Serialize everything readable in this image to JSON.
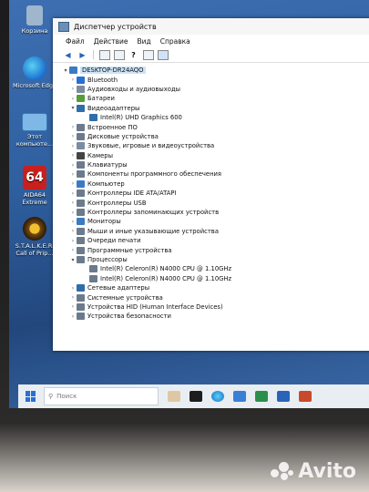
{
  "desktop": {
    "icons": [
      {
        "label": "Корзина"
      },
      {
        "label": "Microsoft Edge"
      },
      {
        "label": "Этот компьюте..."
      },
      {
        "label": "AIDA64 Extreme",
        "badge": "64"
      },
      {
        "label": "S.T.A.L.K.E.R. Call of Prip..."
      }
    ]
  },
  "window": {
    "title": "Диспетчер устройств",
    "menu": [
      "Файл",
      "Действие",
      "Вид",
      "Справка"
    ]
  },
  "tree": {
    "root": "DESKTOP-DR24AQO",
    "items": [
      {
        "label": "Bluetooth",
        "icon": "bluetooth-icon",
        "color": "#2a6fd6",
        "expanded": false
      },
      {
        "label": "Аудиовходы и аудиовыходы",
        "icon": "speaker-icon",
        "color": "#7b8ca0",
        "expanded": false
      },
      {
        "label": "Батареи",
        "icon": "battery-icon",
        "color": "#5a9c3a",
        "expanded": false
      },
      {
        "label": "Видеоадаптеры",
        "icon": "display-adapter-icon",
        "color": "#2f6ea8",
        "expanded": true
      },
      {
        "label": "Intel(R) UHD Graphics 600",
        "icon": "display-adapter-icon",
        "color": "#2f6ea8",
        "child": true
      },
      {
        "label": "Встроенное ПО",
        "icon": "firmware-icon",
        "color": "#6b7b8c",
        "expanded": false
      },
      {
        "label": "Дисковые устройства",
        "icon": "disk-icon",
        "color": "#6b7b8c",
        "expanded": false
      },
      {
        "label": "Звуковые, игровые и видеоустройства",
        "icon": "sound-icon",
        "color": "#7b8ca0",
        "expanded": false
      },
      {
        "label": "Камеры",
        "icon": "camera-icon",
        "color": "#444",
        "expanded": false
      },
      {
        "label": "Клавиатуры",
        "icon": "keyboard-icon",
        "color": "#6b7b8c",
        "expanded": false
      },
      {
        "label": "Компоненты программного обеспечения",
        "icon": "software-icon",
        "color": "#6b7b8c",
        "expanded": false
      },
      {
        "label": "Компьютер",
        "icon": "computer-icon",
        "color": "#3b7bc4",
        "expanded": false
      },
      {
        "label": "Контроллеры IDE ATA/ATAPI",
        "icon": "controller-icon",
        "color": "#6b7b8c",
        "expanded": false
      },
      {
        "label": "Контроллеры USB",
        "icon": "usb-icon",
        "color": "#6b7b8c",
        "expanded": false
      },
      {
        "label": "Контроллеры запоминающих устройств",
        "icon": "storage-icon",
        "color": "#6b7b8c",
        "expanded": false
      },
      {
        "label": "Мониторы",
        "icon": "monitor-icon",
        "color": "#3b7bc4",
        "expanded": false
      },
      {
        "label": "Мыши и иные указывающие устройства",
        "icon": "mouse-icon",
        "color": "#6b7b8c",
        "expanded": false
      },
      {
        "label": "Очереди печати",
        "icon": "printer-icon",
        "color": "#6b7b8c",
        "expanded": false
      },
      {
        "label": "Программные устройства",
        "icon": "software-device-icon",
        "color": "#6b7b8c",
        "expanded": false
      },
      {
        "label": "Процессоры",
        "icon": "processor-icon",
        "color": "#6b7b8c",
        "expanded": true
      },
      {
        "label": "Intel(R) Celeron(R) N4000 CPU @ 1.10GHz",
        "icon": "processor-icon",
        "color": "#6b7b8c",
        "child": true
      },
      {
        "label": "Intel(R) Celeron(R) N4000 CPU @ 1.10GHz",
        "icon": "processor-icon",
        "color": "#6b7b8c",
        "child": true
      },
      {
        "label": "Сетевые адаптеры",
        "icon": "network-icon",
        "color": "#2f6ea8",
        "expanded": false
      },
      {
        "label": "Системные устройства",
        "icon": "system-icon",
        "color": "#6b7b8c",
        "expanded": false
      },
      {
        "label": "Устройства HID (Human Interface Devices)",
        "icon": "hid-icon",
        "color": "#6b7b8c",
        "expanded": false
      },
      {
        "label": "Устройства безопасности",
        "icon": "security-icon",
        "color": "#6b7b8c",
        "expanded": false
      }
    ]
  },
  "taskbar": {
    "search_placeholder": "Поиск"
  },
  "watermark": {
    "text": "Avito"
  }
}
